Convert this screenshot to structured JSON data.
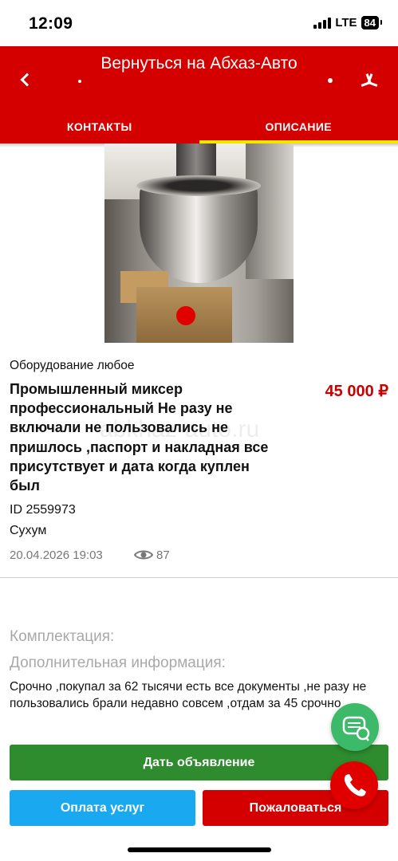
{
  "status_bar": {
    "time": "12:09",
    "network": "LTE",
    "battery": "84"
  },
  "header": {
    "return_link": "Вернуться на Абхаз-Авто",
    "tabs": [
      {
        "label": "КОНТАКТЫ",
        "active": false
      },
      {
        "label": "ОПИСАНИЕ",
        "active": true
      }
    ],
    "accent_color": "#d40000",
    "indicator_color": "#f2e600"
  },
  "listing": {
    "category": "Оборудование любое",
    "title": "Промышленный миксер профессиональный Не разу не включали не пользовались не пришлось ,паспорт и накладная все присутствует и дата когда куплен был",
    "price": "45 000 ₽",
    "watermark": "abkhaz-auto.ru",
    "id": "ID 2559973",
    "city": "Сухум",
    "date": "20.04.2026 19:03",
    "views": "87"
  },
  "details": {
    "equipment_label": "Комплектация:",
    "additional_info_label": "Дополнительная информация:",
    "description": "Срочно ,покупал за 62 тысячи есть все документы ,не разу не пользовались брали недавно совсем ,отдам за 45 срочно"
  },
  "actions": {
    "post_ad": "Дать объявление",
    "pay_services": "Оплата услуг",
    "report": "Пожаловаться"
  },
  "icons": {
    "chat": "chat-icon",
    "call": "phone-icon",
    "views": "eye-icon",
    "back": "back-arrow-icon"
  }
}
